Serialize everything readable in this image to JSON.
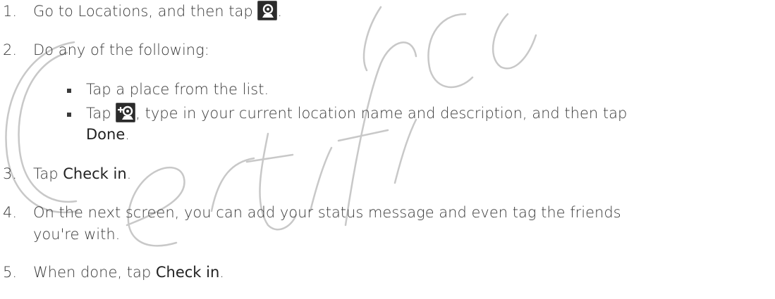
{
  "watermark": {
    "text": "Certificate"
  },
  "steps": [
    {
      "number": "1.",
      "text": "Go to Locations, and then tap",
      "after_icon": ".",
      "icon": "locations-pin-icon"
    },
    {
      "number": "2.",
      "text": "Do any of the following:"
    },
    {
      "number": "3.",
      "text_before": "Tap ",
      "term": "Check in",
      "text_after": "."
    },
    {
      "number": "4.",
      "line1": "On the next screen, you can add your status message and even tag the friends",
      "line2": "you're with."
    },
    {
      "number": "5.",
      "text_before": "When done, tap ",
      "term": "Check in",
      "text_after": "."
    }
  ],
  "bullets": [
    {
      "text": "Tap a place from the list."
    },
    {
      "text_before": "Tap",
      "icon": "add-location-icon",
      "line1_after": ", type in your current location name and description, and then tap",
      "line2_term": "Done",
      "line2_after": "."
    }
  ]
}
